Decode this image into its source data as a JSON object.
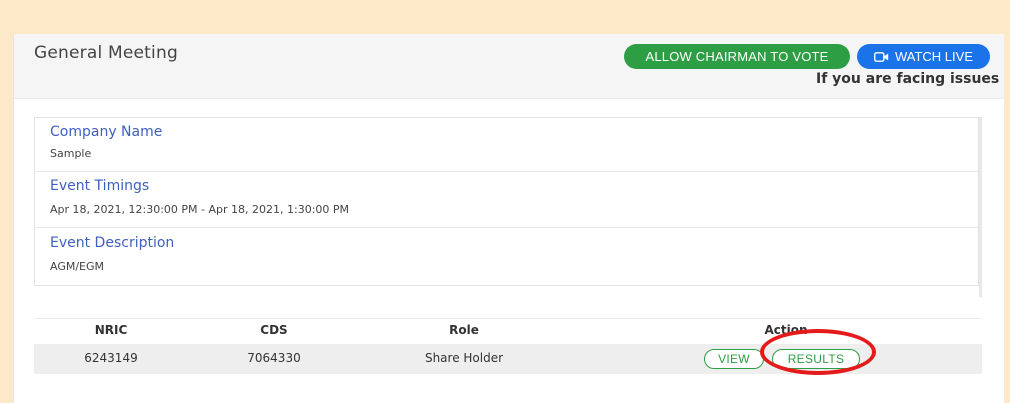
{
  "header": {
    "title": "General Meeting",
    "allow_chairman_label": "ALLOW CHAIRMAN TO VOTE",
    "watch_live_label": "WATCH LIVE",
    "issues_text": "If you are facing issues i"
  },
  "info": {
    "rows": [
      {
        "label": "Company Name",
        "value": "Sample"
      },
      {
        "label": "Event Timings",
        "value": "Apr 18, 2021, 12:30:00 PM - Apr 18, 2021, 1:30:00 PM"
      },
      {
        "label": "Event Description",
        "value": "AGM/EGM"
      }
    ]
  },
  "table": {
    "headers": [
      "NRIC",
      "CDS",
      "Role",
      "Action"
    ],
    "rows": [
      {
        "nric": "6243149",
        "cds": "7064330",
        "role": "Share Holder",
        "view_label": "VIEW",
        "results_label": "RESULTS"
      }
    ]
  },
  "colors": {
    "accent_green": "#2e9e44",
    "accent_blue": "#1a73e8",
    "label_blue": "#3d5fbf",
    "annotation_red": "#e51b1b",
    "background": "#fde9c8"
  },
  "icons": {
    "watch_live": "video-camera-icon"
  }
}
